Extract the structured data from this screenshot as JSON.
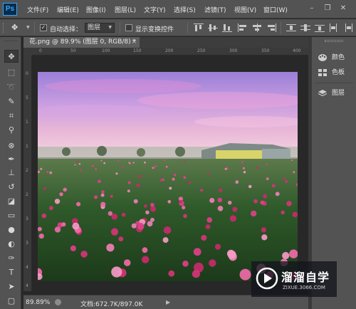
{
  "app": {
    "logo": "Ps"
  },
  "menu": [
    "文件(F)",
    "编辑(E)",
    "图像(I)",
    "图层(L)",
    "文字(Y)",
    "选择(S)",
    "滤镜(T)",
    "视图(V)",
    "窗口(W)"
  ],
  "window_controls": {
    "minimize": "–",
    "restore": "❐",
    "close": "✕"
  },
  "options_bar": {
    "tool_icon": "move-tool-icon",
    "auto_select_label": "自动选择：",
    "auto_select_checked": true,
    "auto_select_value": "图层",
    "show_transform_label": "显示变换控件",
    "show_transform_checked": false
  },
  "tools": [
    "move-tool-icon",
    "marquee-tool-icon",
    "lasso-tool-icon",
    "quick-select-tool-icon",
    "crop-tool-icon",
    "eyedropper-tool-icon",
    "healing-brush-tool-icon",
    "brush-tool-icon",
    "clone-stamp-tool-icon",
    "history-brush-tool-icon",
    "eraser-tool-icon",
    "gradient-tool-icon",
    "blur-tool-icon",
    "dodge-tool-icon",
    "pen-tool-icon",
    "type-tool-icon",
    "path-select-tool-icon",
    "shape-tool-icon"
  ],
  "document": {
    "tab_title": "花.png @ 89.9% (图层 0, RGB/8) *",
    "ruler_h": [
      "0",
      "50",
      "100",
      "150",
      "200",
      "250",
      "300",
      "350",
      "400"
    ],
    "ruler_v": [
      "0",
      "5",
      "1",
      "1",
      "2",
      "2",
      "3",
      "3",
      "4",
      "4"
    ]
  },
  "status": {
    "zoom": "89.89%",
    "doc_size": "文档:672.7K/897.0K"
  },
  "panels": [
    {
      "icon": "palette-icon",
      "label": "颜色"
    },
    {
      "icon": "swatches-icon",
      "label": "色板"
    },
    {
      "icon": "layers-icon",
      "label": "图层"
    }
  ],
  "watermark": {
    "title": "溜溜自学",
    "subtitle": "ZIXUE.3066.COM"
  },
  "colors": {
    "ui_panel": "#535353",
    "ui_dark": "#282828",
    "ps_blue": "#31a8ff"
  }
}
